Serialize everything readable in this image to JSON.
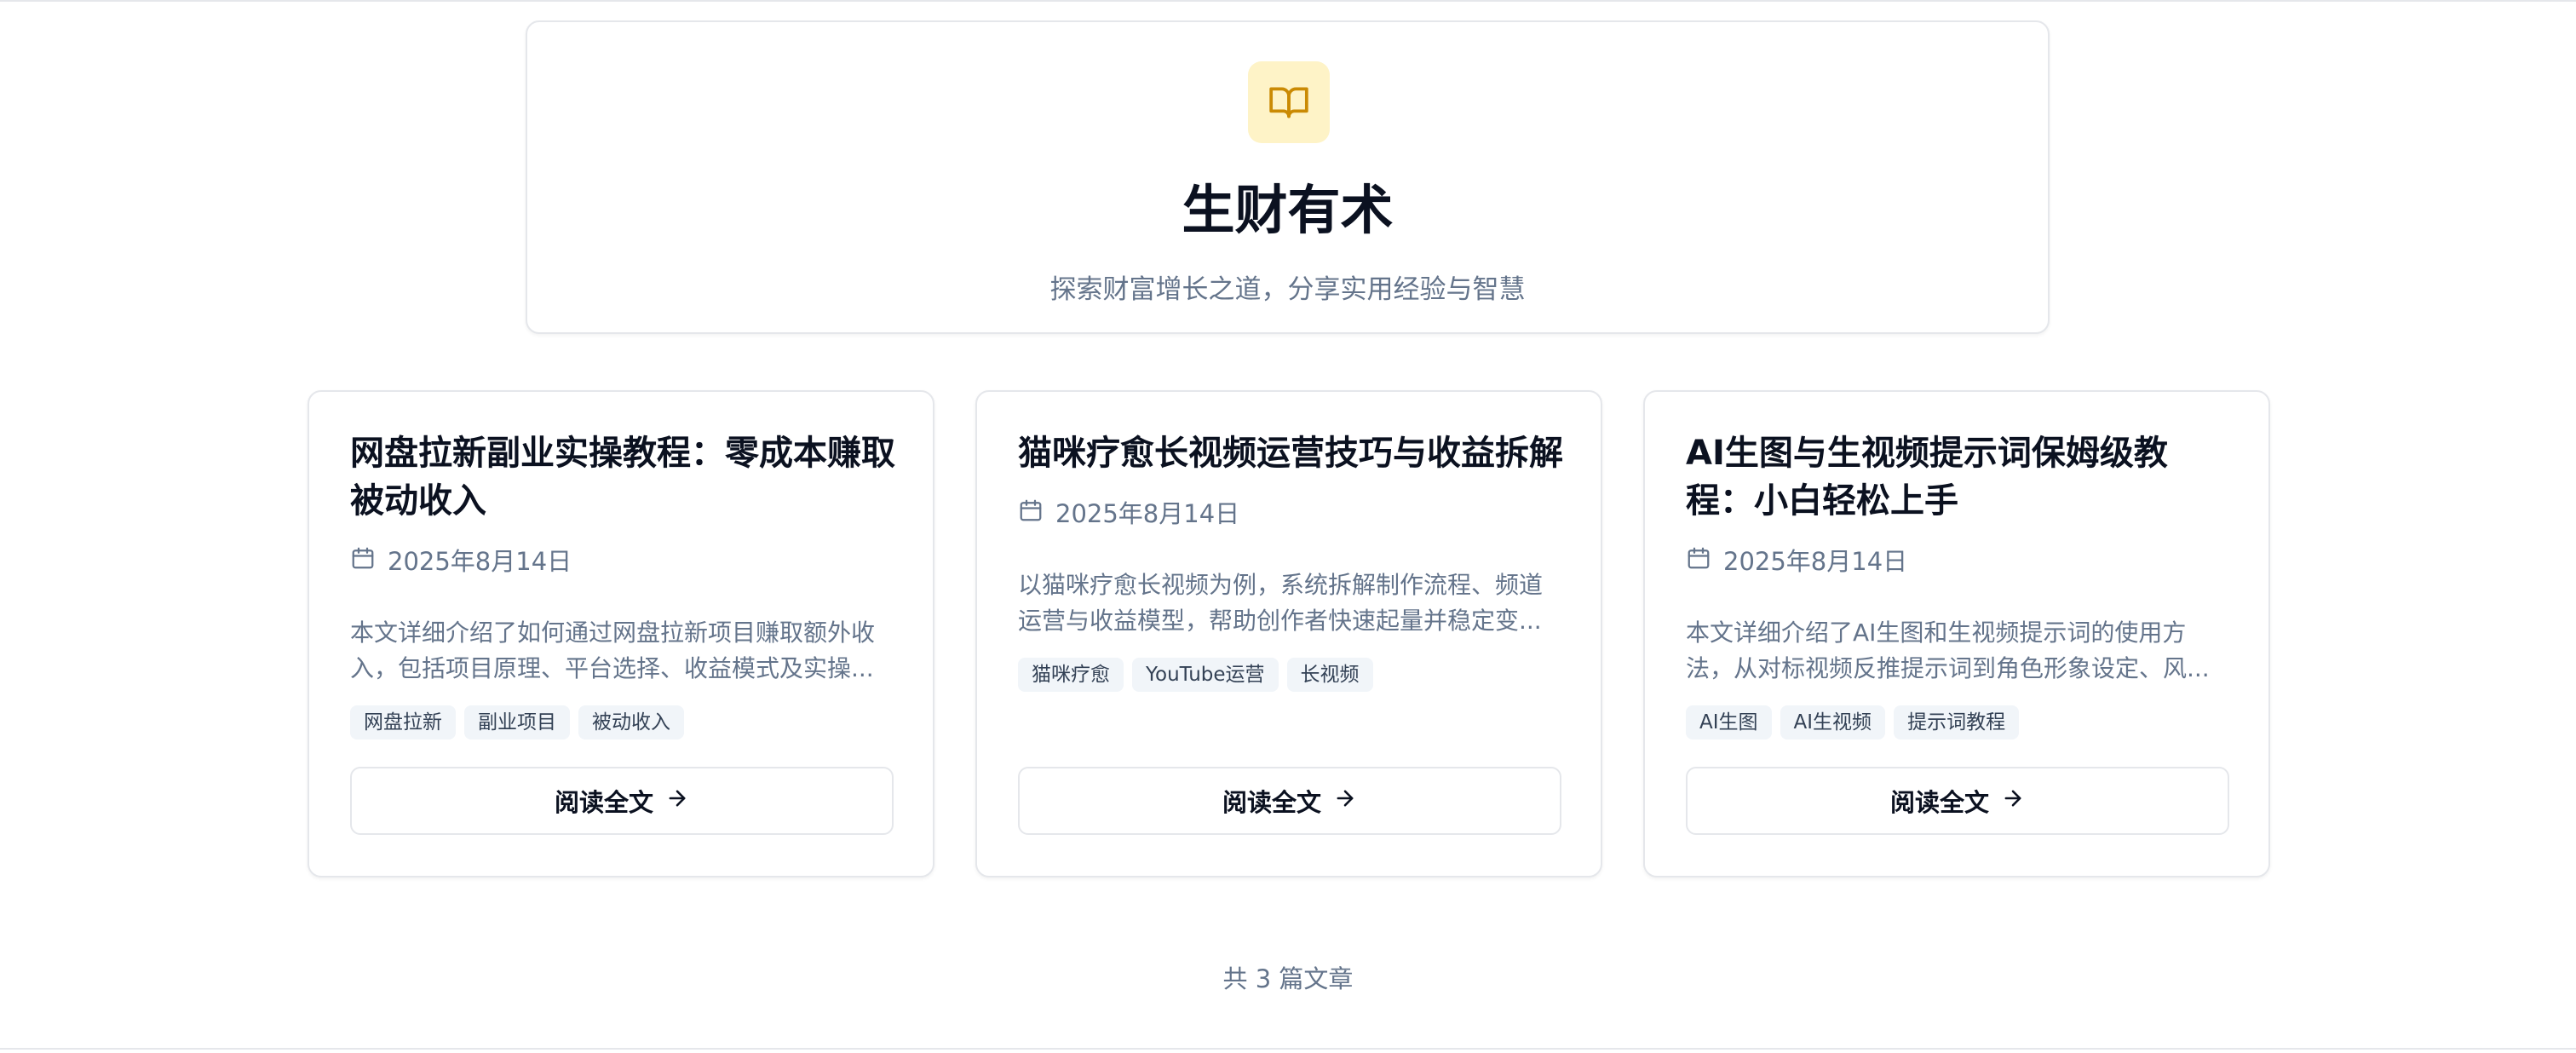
{
  "hero": {
    "icon": "book-open-icon",
    "title": "生财有术",
    "subtitle": "探索财富增长之道，分享实用经验与智慧"
  },
  "articles": [
    {
      "title": "网盘拉新副业实操教程：零成本赚取被动收入",
      "date": "2025年8月14日",
      "excerpt": "本文详细介绍了如何通过网盘拉新项目赚取额外收入，包括项目原理、平台选择、收益模式及实操...",
      "tags": [
        "网盘拉新",
        "副业项目",
        "被动收入"
      ],
      "button_label": "阅读全文"
    },
    {
      "title": "猫咪疗愈长视频运营技巧与收益拆解",
      "date": "2025年8月14日",
      "excerpt": "以猫咪疗愈长视频为例，系统拆解制作流程、频道运营与收益模型，帮助创作者快速起量并稳定变...",
      "tags": [
        "猫咪疗愈",
        "YouTube运营",
        "长视频"
      ],
      "button_label": "阅读全文"
    },
    {
      "title": "AI生图与生视频提示词保姆级教程：小白轻松上手",
      "date": "2025年8月14日",
      "excerpt": "本文详细介绍了AI生图和生视频提示词的使用方法，从对标视频反推提示词到角色形象设定、风...",
      "tags": [
        "AI生图",
        "AI生视频",
        "提示词教程"
      ],
      "button_label": "阅读全文"
    }
  ],
  "footer": {
    "count_text": "共 3 篇文章"
  },
  "colors": {
    "icon_bg": "#fef3c7",
    "icon_stroke": "#ca8a04",
    "muted_text": "#64748b",
    "border": "#e5e7eb"
  }
}
